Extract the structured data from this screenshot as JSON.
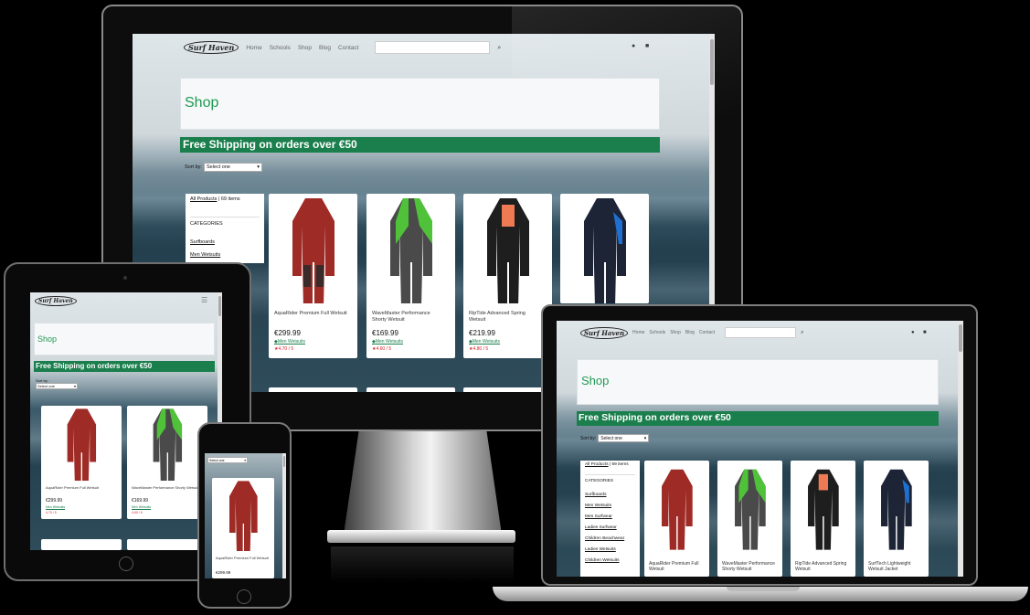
{
  "site": {
    "logo_text": "Surf Haven",
    "nav": [
      "Home",
      "Schools",
      "Shop",
      "Blog",
      "Contact"
    ],
    "search_placeholder": "",
    "page_title": "Shop",
    "promo": "Free Shipping on orders over €50",
    "sort_label": "Sort by:",
    "sort_value": "Select one",
    "all_products_label": "All Products",
    "items_count": "| 69 items",
    "categories_heading": "CATEGORIES",
    "categories": [
      "Surfboards",
      "Men Wetsuits",
      "Men Surfwear",
      "Ladies Surfwear",
      "Children Beachwear",
      "Ladies Wetsuits",
      "Children Wetsuits"
    ]
  },
  "products": [
    {
      "name": "AquaRider Premium Full Wetsuit",
      "price": "€299.99",
      "category": "Men Wetsuits",
      "rating": "4.70 / 5",
      "suit_color": "#9e2b25",
      "accent": "#3a2b2a"
    },
    {
      "name": "WaveMaster Performance Shorty Wetsuit",
      "price": "€169.99",
      "category": "Men Wetsuits",
      "rating": "4.60 / 5",
      "suit_color": "#4a4a4a",
      "accent": "#4fc23a"
    },
    {
      "name": "RipTide Advanced Spring Wetsuit",
      "price": "€219.99",
      "category": "Men Wetsuits",
      "rating": "4.80 / 5",
      "suit_color": "#1e1e1e",
      "accent": "#ef7b55"
    },
    {
      "name": "SurfTech Lightweight Wetsuit Jacket",
      "price": "",
      "category": "",
      "rating": "",
      "suit_color": "#1c2436",
      "accent": "#1f6fd1"
    }
  ],
  "colors": {
    "brand_green": "#1b7f4d",
    "title_green": "#1f9a52",
    "rating_red": "#d9232d"
  },
  "icons": [
    "search-icon",
    "user-icon",
    "cart-icon",
    "hamburger-menu-icon",
    "star-icon",
    "tag-icon"
  ]
}
